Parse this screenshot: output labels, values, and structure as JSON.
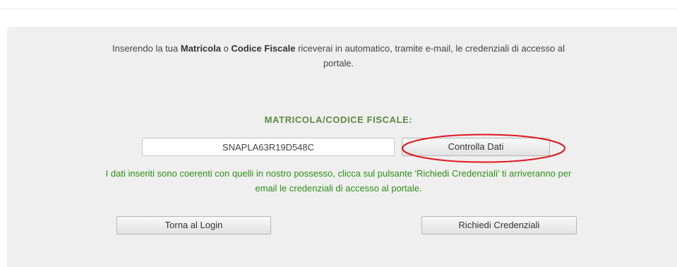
{
  "intro": {
    "pre": "Inserendo la tua ",
    "matricola": "Matricola",
    "middle": " o ",
    "codice_fiscale": "Codice Fiscale",
    "post_line1": " riceverai in automatico, tramite e-mail, le credenziali di accesso al",
    "line2": "portale."
  },
  "form": {
    "label": "MATRICOLA/CODICE FISCALE:",
    "input_value": "SNAPLA63R19D548C",
    "check_button": "Controlla Dati"
  },
  "message": {
    "line1": "I dati inseriti sono coerenti con quelli in nostro possesso, clicca sul pulsante 'Richiedi Credenziali' ti arriveranno per",
    "line2": "email le credenziali di accesso al portale."
  },
  "actions": {
    "back_to_login": "Torna al Login",
    "request_credentials": "Richiedi Credenziali"
  },
  "colors": {
    "label_green": "#5d8a43",
    "message_green": "#2f8f1a",
    "annotation_red": "#e0141e",
    "panel_bg": "#efefef"
  }
}
